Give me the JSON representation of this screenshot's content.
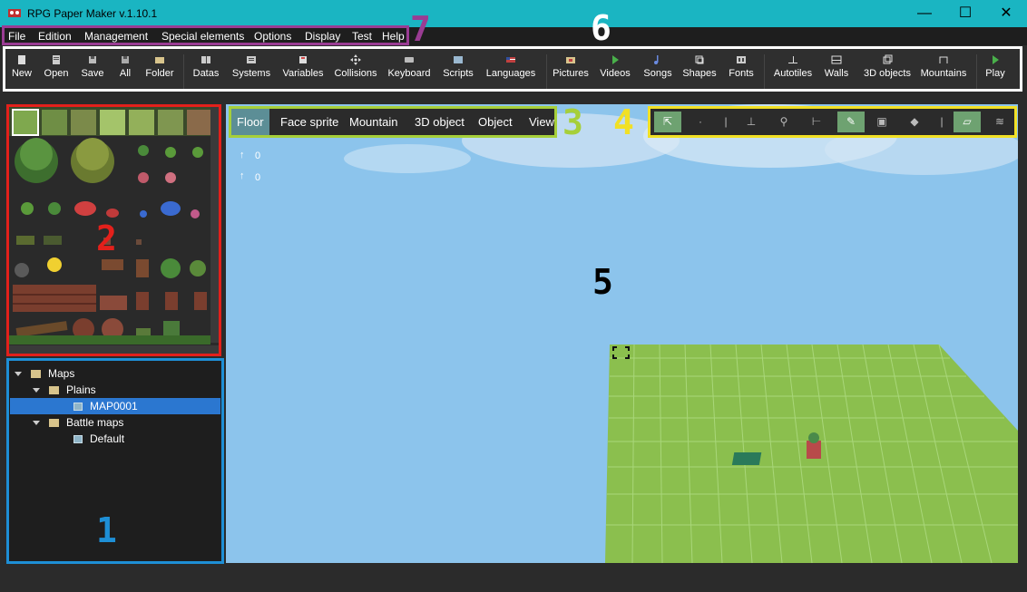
{
  "window": {
    "title": "RPG Paper Maker v.1.10.1",
    "minimize": "—",
    "maximize": "☐",
    "close": "✕"
  },
  "menu": [
    "File",
    "Edition",
    "Management",
    "Special elements",
    "Options",
    "Display",
    "Test",
    "Help"
  ],
  "toolbar": [
    "New",
    "Open",
    "Save",
    "All",
    "Folder",
    "Datas",
    "Systems",
    "Variables",
    "Collisions",
    "Keyboard",
    "Scripts",
    "Languages",
    "Pictures",
    "Videos",
    "Songs",
    "Shapes",
    "Fonts",
    "Autotiles",
    "Walls",
    "3D objects",
    "Mountains",
    "Play"
  ],
  "map_tabs": [
    "Floor",
    "Face sprite",
    "Mountain",
    "3D object",
    "Object",
    "View"
  ],
  "tree": {
    "root": "Maps",
    "folder1": "Plains",
    "map1": "MAP0001",
    "folder2": "Battle maps",
    "map2": "Default"
  },
  "coords": {
    "y": "0",
    "z": "0"
  },
  "annotations": {
    "n1": "1",
    "n2": "2",
    "n3": "3",
    "n4": "4",
    "n5": "5",
    "n6": "6",
    "n7": "7"
  },
  "colors": {
    "titlebar": "#1ab5c2",
    "box1": "#1e8fd6",
    "box2": "#e3201b",
    "box3": "#a6cf3a",
    "box4": "#f1e025",
    "box6": "#ffffff",
    "box7": "#9a3c93",
    "sky": "#8cc4ec",
    "grass": "#8bbf4e"
  }
}
